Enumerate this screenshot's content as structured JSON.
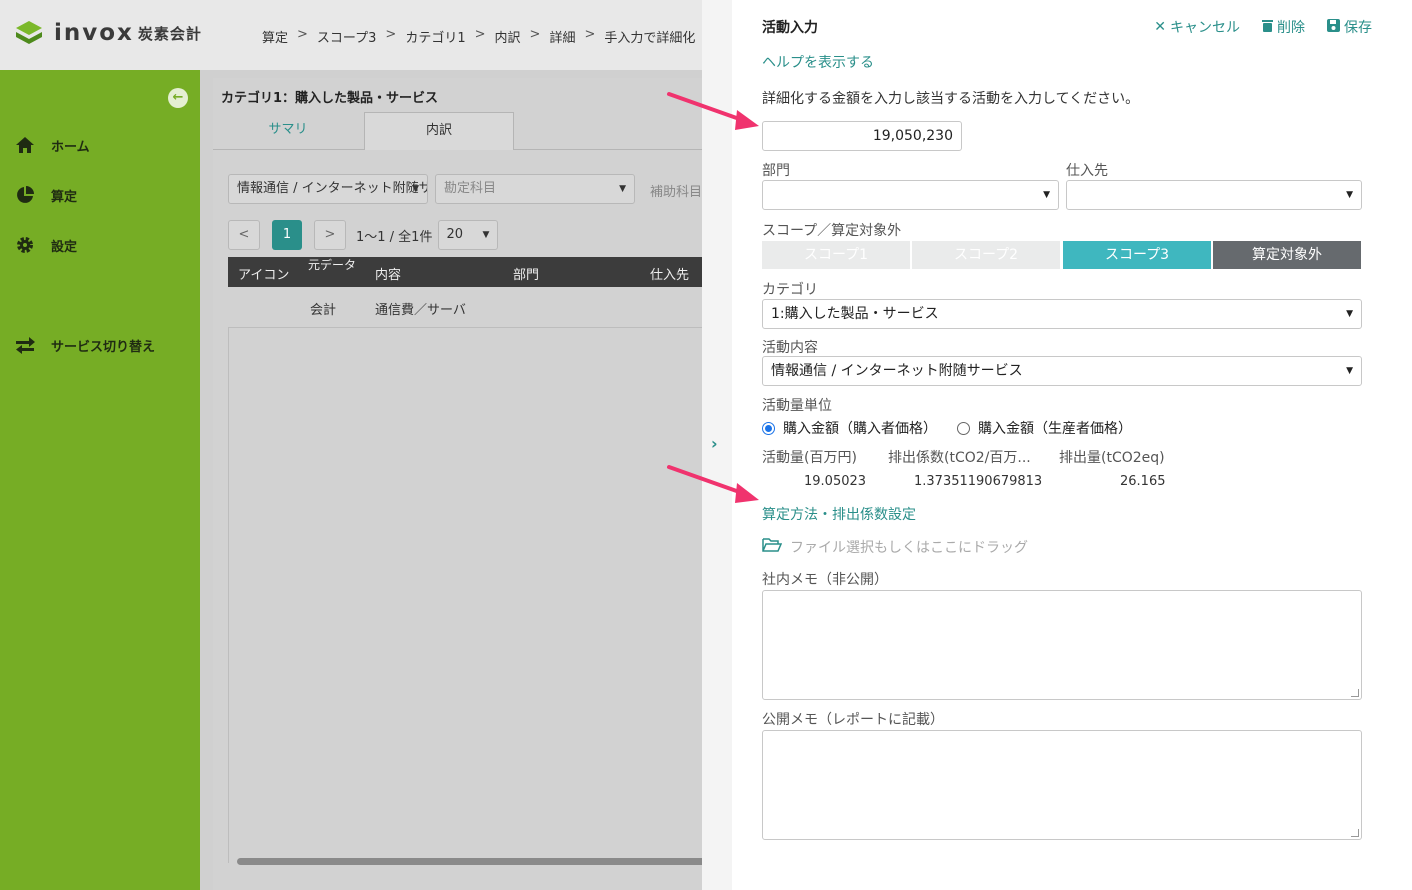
{
  "app": {
    "logo_text": "invox",
    "logo_sub": "炭素会計",
    "breadcrumb": [
      "算定",
      "スコープ3",
      "カテゴリ1",
      "内訳",
      "詳細",
      "手入力で詳細化"
    ]
  },
  "sidebar": {
    "items": [
      {
        "label": "ホーム",
        "icon": "home-icon"
      },
      {
        "label": "算定",
        "icon": "pie-chart-icon"
      },
      {
        "label": "設定",
        "icon": "gear-icon"
      },
      {
        "label": "サービス切り替え",
        "icon": "switch-icon"
      }
    ]
  },
  "main": {
    "title": "カテゴリ1：購入した製品・サービス",
    "tabs": [
      "サマリ",
      "内訳"
    ],
    "filters": {
      "activity": "情報通信 / インターネット附随サービス",
      "account_placeholder": "勘定科目",
      "sub_account_placeholder": "補助科目"
    },
    "pager": {
      "current": "1",
      "range": "1〜1 / 全1件",
      "per_page": "20"
    },
    "table": {
      "headers": [
        "アイコン",
        "元データ",
        "内容",
        "部門",
        "仕入先"
      ],
      "rows": [
        {
          "source": "会計",
          "content": "通信費／サーバ"
        }
      ]
    }
  },
  "panel": {
    "title": "活動入力",
    "actions": {
      "cancel": "キャンセル",
      "delete": "削除",
      "save": "保存"
    },
    "help_link": "ヘルプを表示する",
    "instruction": "詳細化する金額を入力し該当する活動を入力してください。",
    "amount": "19,050,230",
    "department_label": "部門",
    "supplier_label": "仕入先",
    "scope_label": "スコープ／算定対象外",
    "scopes": [
      "スコープ1",
      "スコープ2",
      "スコープ3",
      "算定対象外"
    ],
    "selected_scope": "スコープ3",
    "category_label": "カテゴリ",
    "category_value": "1:購入した製品・サービス",
    "activity_label": "活動内容",
    "activity_value": "情報通信 / インターネット附随サービス",
    "unit_label": "活動量単位",
    "units": [
      "購入金額（購入者価格）",
      "購入金額（生産者価格）"
    ],
    "selected_unit": "購入金額（購入者価格）",
    "calc": {
      "headers": [
        "活動量(百万円)",
        "排出係数(tCO2/百万...",
        "排出量(tCO2eq)"
      ],
      "values": [
        "19.05023",
        "1.37351190679813",
        "26.165"
      ]
    },
    "method_link": "算定方法・排出係数設定",
    "file_drop": "ファイル選択もしくはここにドラッグ",
    "internal_memo_label": "社内メモ（非公開）",
    "public_memo_label": "公開メモ（レポートに記載）"
  },
  "colors": {
    "sidebar": "#76ad25",
    "accent": "#2a8f8a",
    "scope_selected": "#3fb7bf",
    "scope_excluded": "#666a6e",
    "annotation_arrow": "#f0336e"
  }
}
